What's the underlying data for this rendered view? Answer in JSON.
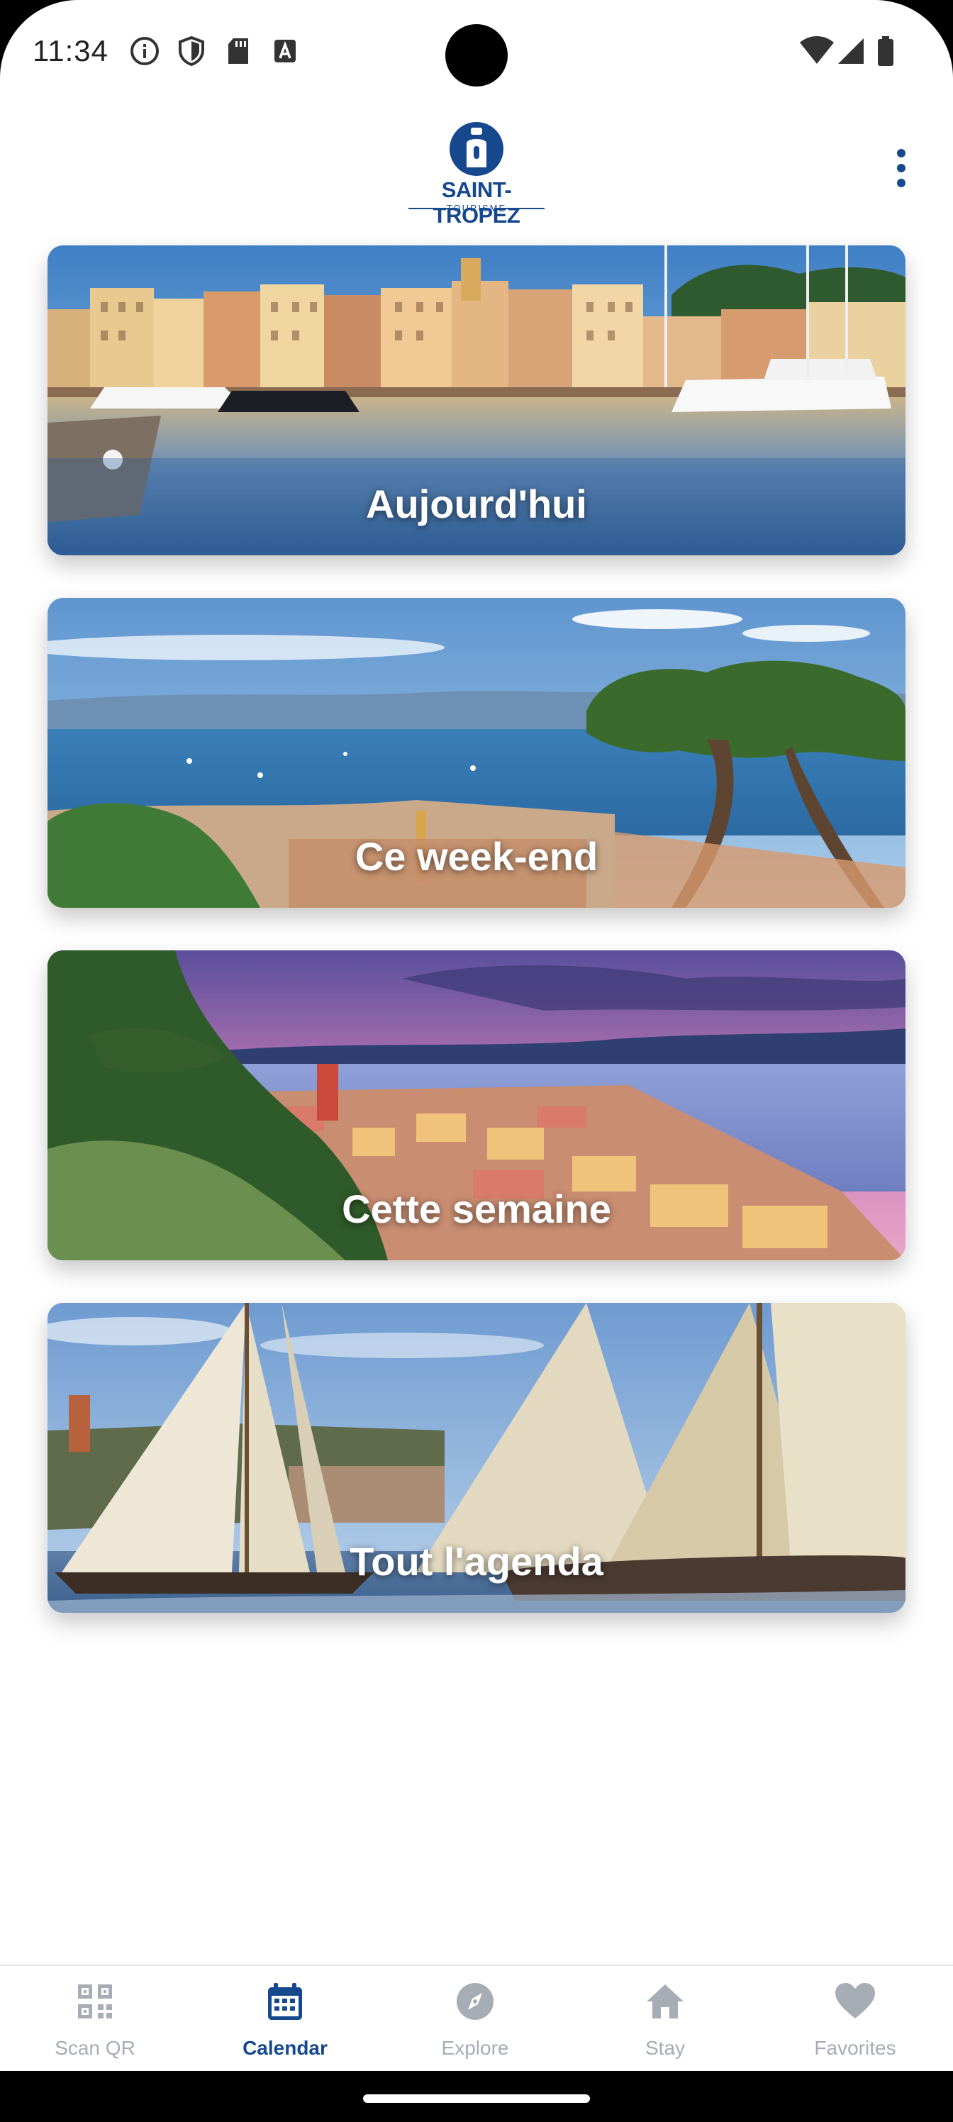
{
  "status_bar": {
    "time": "11:34",
    "left_icons": [
      "info-icon",
      "shield-icon",
      "sd-card-icon",
      "font-icon"
    ],
    "right_icons": [
      "wifi-icon",
      "signal-icon",
      "battery-icon"
    ]
  },
  "app_bar": {
    "logo_name": "SAINT-TROPEZ",
    "logo_sub": "TOURISME",
    "menu_icon": "more-vertical-icon"
  },
  "cards": [
    {
      "label": "Aujourd'hui",
      "scene": "harbour"
    },
    {
      "label": "Ce week-end",
      "scene": "bay"
    },
    {
      "label": "Cette semaine",
      "scene": "sunset"
    },
    {
      "label": "Tout l'agenda",
      "scene": "sailing"
    }
  ],
  "bottom_nav": {
    "items": [
      {
        "label": "Scan QR",
        "icon": "qr-code-icon",
        "active": false
      },
      {
        "label": "Calendar",
        "icon": "calendar-icon",
        "active": true
      },
      {
        "label": "Explore",
        "icon": "compass-icon",
        "active": false
      },
      {
        "label": "Stay",
        "icon": "home-icon",
        "active": false
      },
      {
        "label": "Favorites",
        "icon": "heart-icon",
        "active": false
      }
    ]
  },
  "colors": {
    "brand": "#16488e",
    "nav_inactive": "#a7adb5",
    "background": "#ffffff"
  }
}
